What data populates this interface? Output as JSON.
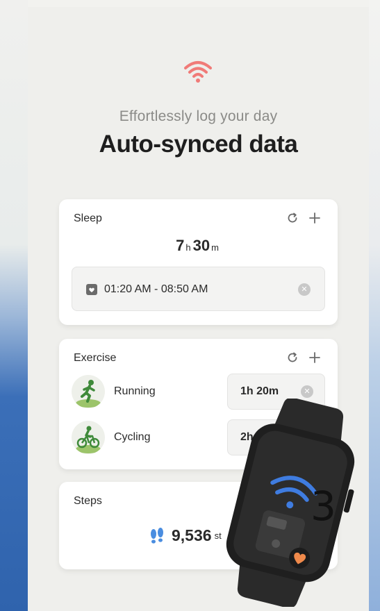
{
  "header": {
    "subtitle": "Effortlessly log your day",
    "title": "Auto-synced data"
  },
  "sleep": {
    "title": "Sleep",
    "hours": "7",
    "hours_unit": "h",
    "minutes": "30",
    "minutes_unit": "m",
    "time_range": "01:20 AM - 08:50 AM"
  },
  "exercise": {
    "title": "Exercise",
    "items": [
      {
        "name": "Running",
        "duration": "1h 20m"
      },
      {
        "name": "Cycling",
        "duration": "2h"
      }
    ]
  },
  "steps": {
    "title": "Steps",
    "count": "9,536",
    "unit_fragment": "st"
  },
  "watch": {
    "badge_number": "3"
  },
  "icons": {
    "sync": "sync-icon",
    "add": "plus-icon",
    "calendar": "calendar-icon",
    "clear": "clear-icon",
    "footsteps": "footsteps-icon",
    "wifi": "wifi-icon",
    "heart": "heart-icon"
  },
  "colors": {
    "accent_wifi": "#f07b78",
    "watch_wifi": "#3f7ce0",
    "heart": "#f08a4b",
    "steps_icon": "#4a8de0"
  }
}
